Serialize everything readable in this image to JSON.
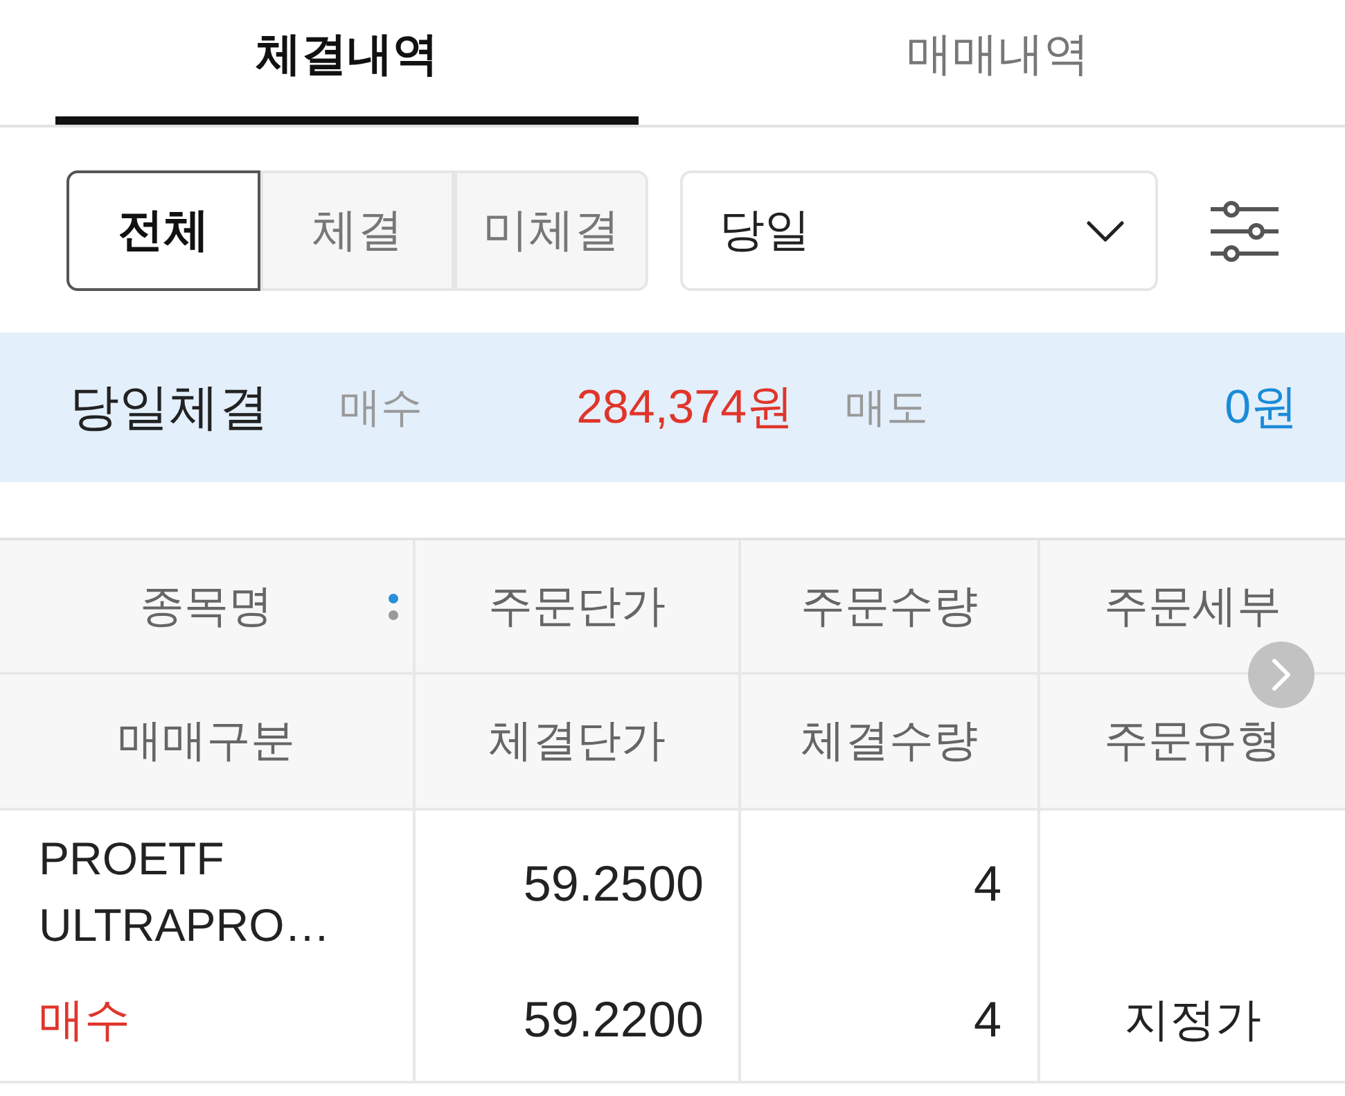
{
  "tabs": [
    {
      "label": "체결내역",
      "selected": true
    },
    {
      "label": "매매내역",
      "selected": false
    }
  ],
  "filter": {
    "segments": [
      {
        "label": "전체",
        "selected": true
      },
      {
        "label": "체결",
        "selected": false
      },
      {
        "label": "미체결",
        "selected": false
      }
    ],
    "period_select": {
      "value": "당일"
    }
  },
  "summary": {
    "title": "당일체결",
    "totals": [
      {
        "kind": "buy",
        "label": "매수",
        "amount": "284,374원"
      },
      {
        "kind": "sell",
        "label": "매도",
        "amount": "0원"
      }
    ]
  },
  "table": {
    "header_rows": [
      [
        "종목명",
        "주문단가",
        "주문수량",
        "주문세부"
      ],
      [
        "매매구분",
        "체결단가",
        "체결수량",
        "주문유형"
      ]
    ],
    "rows": [
      {
        "name": "PROETF ULTRAPRO…",
        "order_price": "59.2500",
        "order_quantity": "4",
        "side": {
          "kind": "buy",
          "label": "매수"
        },
        "fill_price": "59.2200",
        "fill_quantity": "4",
        "order_type": "지정가"
      }
    ]
  }
}
